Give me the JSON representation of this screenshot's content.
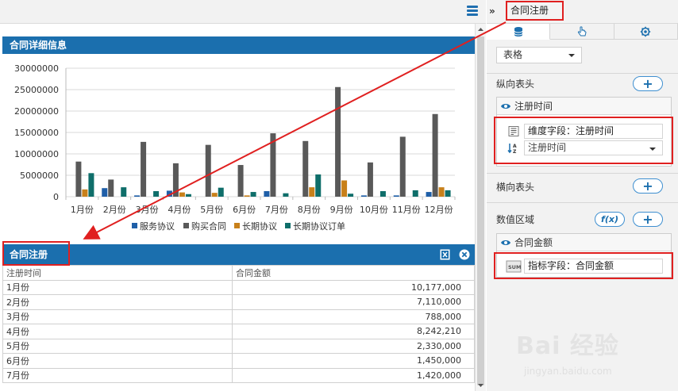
{
  "left": {
    "chart_panel_title": "合同详细信息",
    "table_panel_title": "合同注册",
    "table": {
      "columns": [
        "注册时间",
        "合同金额"
      ],
      "rows": [
        [
          "1月份",
          "10,177,000"
        ],
        [
          "2月份",
          "7,110,000"
        ],
        [
          "3月份",
          "788,000"
        ],
        [
          "4月份",
          "8,242,210"
        ],
        [
          "5月份",
          "2,330,000"
        ],
        [
          "6月份",
          "1,450,000"
        ],
        [
          "7月份",
          "1,420,000"
        ]
      ]
    }
  },
  "right": {
    "header_title": "合同注册",
    "type_select": "表格",
    "vertical_header": {
      "label": "纵向表头",
      "field_name": "注册时间",
      "dimension_text": "维度字段：注册时间",
      "sort_select": "注册时间"
    },
    "horizontal_header": {
      "label": "横向表头"
    },
    "value_area": {
      "label": "数值区域",
      "fx_label": "f(x)",
      "field_name": "合同金额",
      "metric_text": "指标字段：合同金额",
      "sum_label": "SUM"
    }
  },
  "watermark": {
    "brand": "Bai 经验",
    "url": "jingyan.baidu.com"
  },
  "colors": {
    "header_blue": "#1b6fae",
    "series": [
      "#1f5fa8",
      "#595959",
      "#c8801a",
      "#0f6e6a"
    ],
    "annotation_red": "#e02020"
  },
  "chart_data": {
    "type": "bar",
    "categories": [
      "1月份",
      "2月份",
      "3月份",
      "4月份",
      "5月份",
      "6月份",
      "7月份",
      "8月份",
      "9月份",
      "10月份",
      "11月份",
      "12月份"
    ],
    "series": [
      {
        "name": "服务协议",
        "values": [
          0,
          2000000,
          300000,
          1400000,
          0,
          0,
          1300000,
          0,
          0,
          300000,
          300000,
          1100000
        ]
      },
      {
        "name": "购买合同",
        "values": [
          8200000,
          4000000,
          12800000,
          7800000,
          12100000,
          7400000,
          14800000,
          13000000,
          25600000,
          8000000,
          14000000,
          19300000
        ]
      },
      {
        "name": "长期协议",
        "values": [
          1700000,
          0,
          0,
          1000000,
          900000,
          300000,
          0,
          2200000,
          3800000,
          0,
          0,
          2200000
        ]
      },
      {
        "name": "长期协议订单",
        "values": [
          5500000,
          2200000,
          1300000,
          600000,
          2100000,
          1100000,
          800000,
          5200000,
          700000,
          1300000,
          1500000,
          1500000
        ]
      }
    ],
    "yticks": [
      "30000000",
      "25000000",
      "20000000",
      "15000000",
      "10000000",
      "5000000",
      "0"
    ],
    "ylim": [
      0,
      30000000
    ],
    "grid": true,
    "legend": "bottom"
  }
}
